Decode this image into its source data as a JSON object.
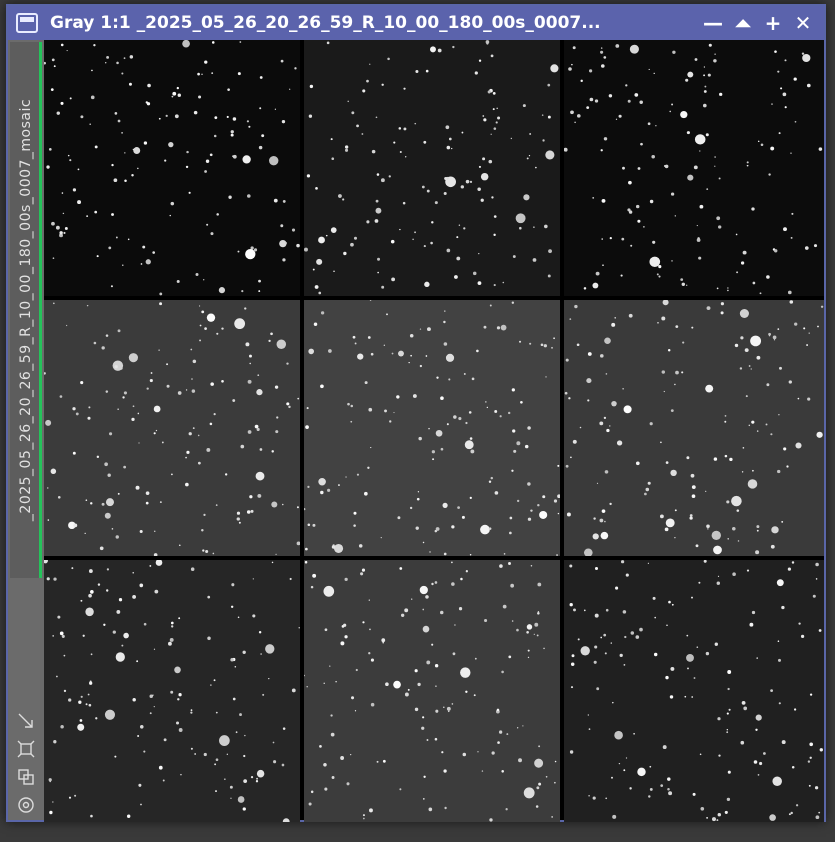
{
  "window": {
    "title": "Gray 1:1 _2025_05_26_20_26_59_R_10_00_180_00s_0007...",
    "buttons": [
      {
        "name": "minimize-button",
        "glyph": "—"
      },
      {
        "name": "shade-button",
        "glyph": "⏶"
      },
      {
        "name": "maximize-button",
        "glyph": "+"
      },
      {
        "name": "close-button",
        "glyph": "✕"
      }
    ]
  },
  "sidebar": {
    "image_id": "_2025_05_26_20_26_59_R_10_00_180_00s_0007_mosaic",
    "tools": [
      "fit-view-icon",
      "zoom-fit-icon",
      "clone-icon",
      "target-icon"
    ]
  },
  "mosaic": {
    "rows": 3,
    "cols": 3,
    "tiles": [
      {
        "bg": "#0b0b0b",
        "seed": 11
      },
      {
        "bg": "#1a1a1a",
        "seed": 23
      },
      {
        "bg": "#0c0c0c",
        "seed": 37
      },
      {
        "bg": "#3b3b3b",
        "seed": 41
      },
      {
        "bg": "#424242",
        "seed": 53
      },
      {
        "bg": "#3a3a3a",
        "seed": 67
      },
      {
        "bg": "#262626",
        "seed": 71
      },
      {
        "bg": "#3c3c3c",
        "seed": 83
      },
      {
        "bg": "#202020",
        "seed": 97
      }
    ]
  },
  "colors": {
    "titlebar": "#5b63ac",
    "active_tab": "#25c25a"
  }
}
